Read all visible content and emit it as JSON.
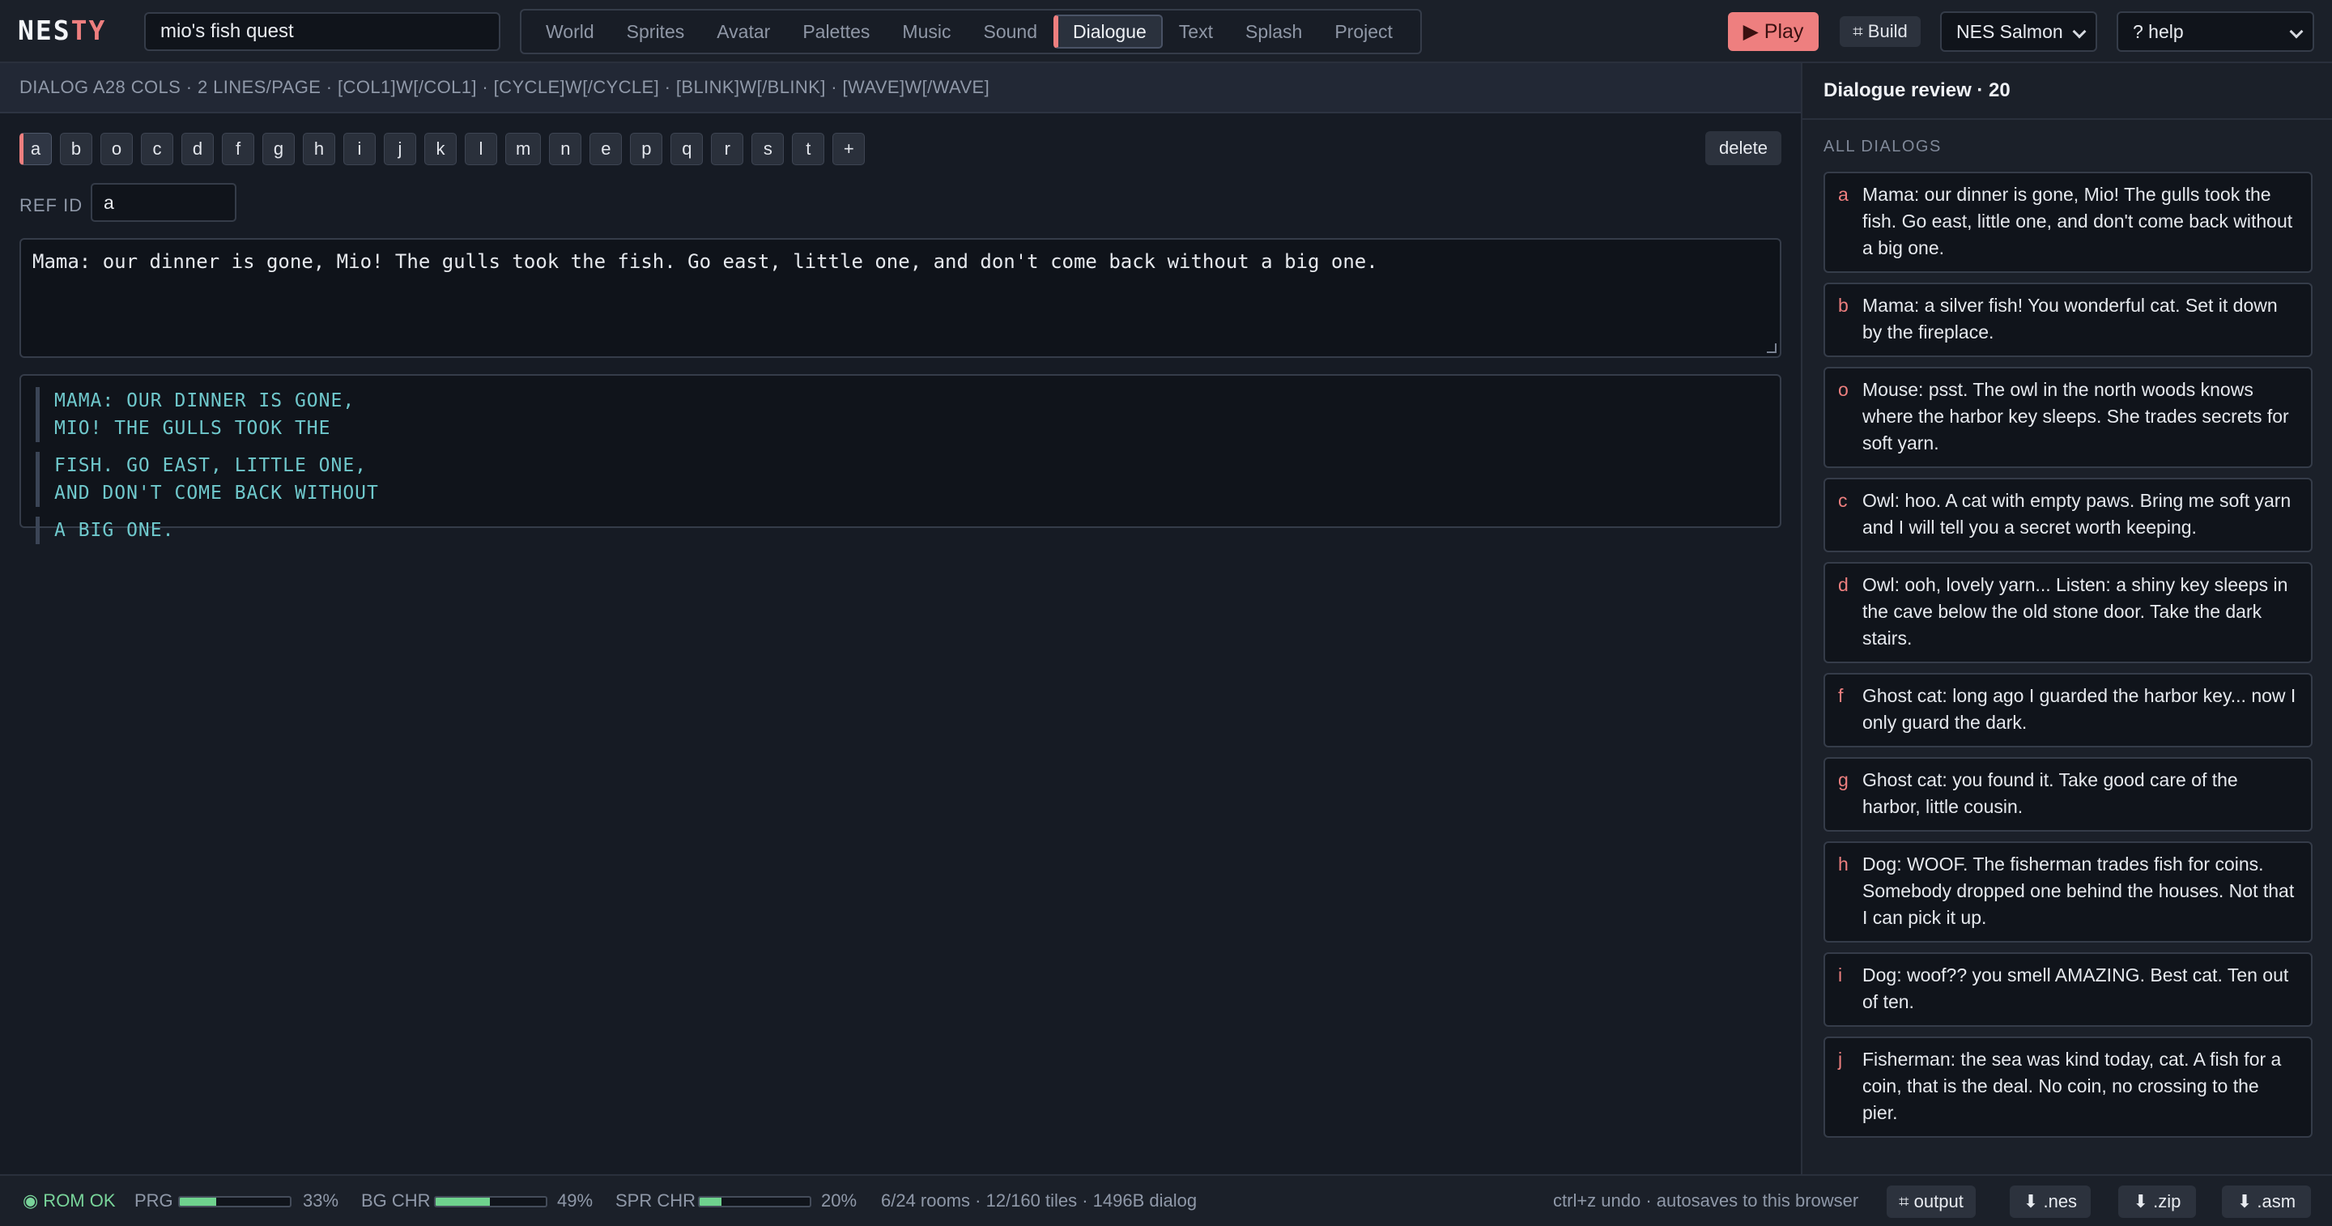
{
  "app": {
    "logo_a": "NES",
    "logo_b": "TY",
    "project_name": "mio's fish quest"
  },
  "nav": {
    "tabs": [
      {
        "label": "World",
        "active": false
      },
      {
        "label": "Sprites",
        "active": false
      },
      {
        "label": "Avatar",
        "active": false
      },
      {
        "label": "Palettes",
        "active": false
      },
      {
        "label": "Music",
        "active": false
      },
      {
        "label": "Sound",
        "active": false
      },
      {
        "label": "Dialogue",
        "active": true
      },
      {
        "label": "Text",
        "active": false
      },
      {
        "label": "Splash",
        "active": false
      },
      {
        "label": "Project",
        "active": false
      }
    ]
  },
  "actions": {
    "play_label": "▶ Play",
    "build_label": "⌗ Build",
    "palette_value": "NES Salmon",
    "help_value": "? help"
  },
  "editor": {
    "header": "DIALOG A28 COLS · 2 LINES/PAGE · [COL1]W[/COL1] · [CYCLE]W[/CYCLE] · [BLINK]W[/BLINK] · [WAVE]W[/WAVE]",
    "ids": [
      "a",
      "b",
      "o",
      "c",
      "d",
      "f",
      "g",
      "h",
      "i",
      "j",
      "k",
      "l",
      "m",
      "n",
      "e",
      "p",
      "q",
      "r",
      "s",
      "t",
      "+"
    ],
    "active_id": "a",
    "delete_label": "delete",
    "ref_label": "REF ID",
    "ref_value": "a",
    "text": "Mama: our dinner is gone, Mio! The gulls took the fish. Go east, little one, and don't come back without a big one.",
    "preview_pages": [
      [
        "MAMA: OUR DINNER IS GONE,",
        "MIO! THE GULLS TOOK THE"
      ],
      [
        "FISH. GO EAST, LITTLE ONE,",
        "AND DON'T COME BACK WITHOUT"
      ],
      [
        "A BIG ONE."
      ]
    ]
  },
  "review": {
    "title": "Dialogue review · 20",
    "section_label": "ALL DIALOGS",
    "items": [
      {
        "key": "a",
        "text": "Mama: our dinner is gone, Mio! The gulls took the fish. Go east, little one, and don't come back without a big one."
      },
      {
        "key": "b",
        "text": "Mama: a silver fish! You wonderful cat. Set it down by the fireplace."
      },
      {
        "key": "o",
        "text": "Mouse: psst. The owl in the north woods knows where the harbor key sleeps. She trades secrets for soft yarn."
      },
      {
        "key": "c",
        "text": "Owl: hoo. A cat with empty paws. Bring me soft yarn and I will tell you a secret worth keeping."
      },
      {
        "key": "d",
        "text": "Owl: ooh, lovely yarn... Listen: a shiny key sleeps in the cave below the old stone door. Take the dark stairs."
      },
      {
        "key": "f",
        "text": "Ghost cat: long ago I guarded the harbor key... now I only guard the dark."
      },
      {
        "key": "g",
        "text": "Ghost cat: you found it. Take good care of the harbor, little cousin."
      },
      {
        "key": "h",
        "text": "Dog: WOOF. The fisherman trades fish for coins. Somebody dropped one behind the houses. Not that I can pick it up."
      },
      {
        "key": "i",
        "text": "Dog: woof?? you smell AMAZING. Best cat. Ten out of ten."
      },
      {
        "key": "j",
        "text": "Fisherman: the sea was kind today, cat. A fish for a coin, that is the deal. No coin, no crossing to the pier."
      }
    ]
  },
  "status": {
    "rom": "◉ ROM OK",
    "prg_label": "PRG",
    "prg_fraction": 0.33,
    "prg_pct": "33%",
    "bg_label": "BG CHR",
    "bg_fraction": 0.49,
    "bg_pct": "49%",
    "spr_label": "SPR CHR",
    "spr_fraction": 0.2,
    "spr_pct": "20%",
    "summary": "6/24 rooms · 12/160 tiles · 1496B dialog",
    "hint": "ctrl+z undo · autosaves to this browser",
    "output_label": "⌗ output",
    "nes_label": "⬇ .nes",
    "zip_label": "⬇ .zip",
    "asm_label": "⬇ .asm"
  },
  "colors": {
    "accent": "#ee7f7f",
    "preview_text": "#6fc8cc",
    "meter_fill": "#6fd28e",
    "rom_ok": "#79d49a"
  }
}
